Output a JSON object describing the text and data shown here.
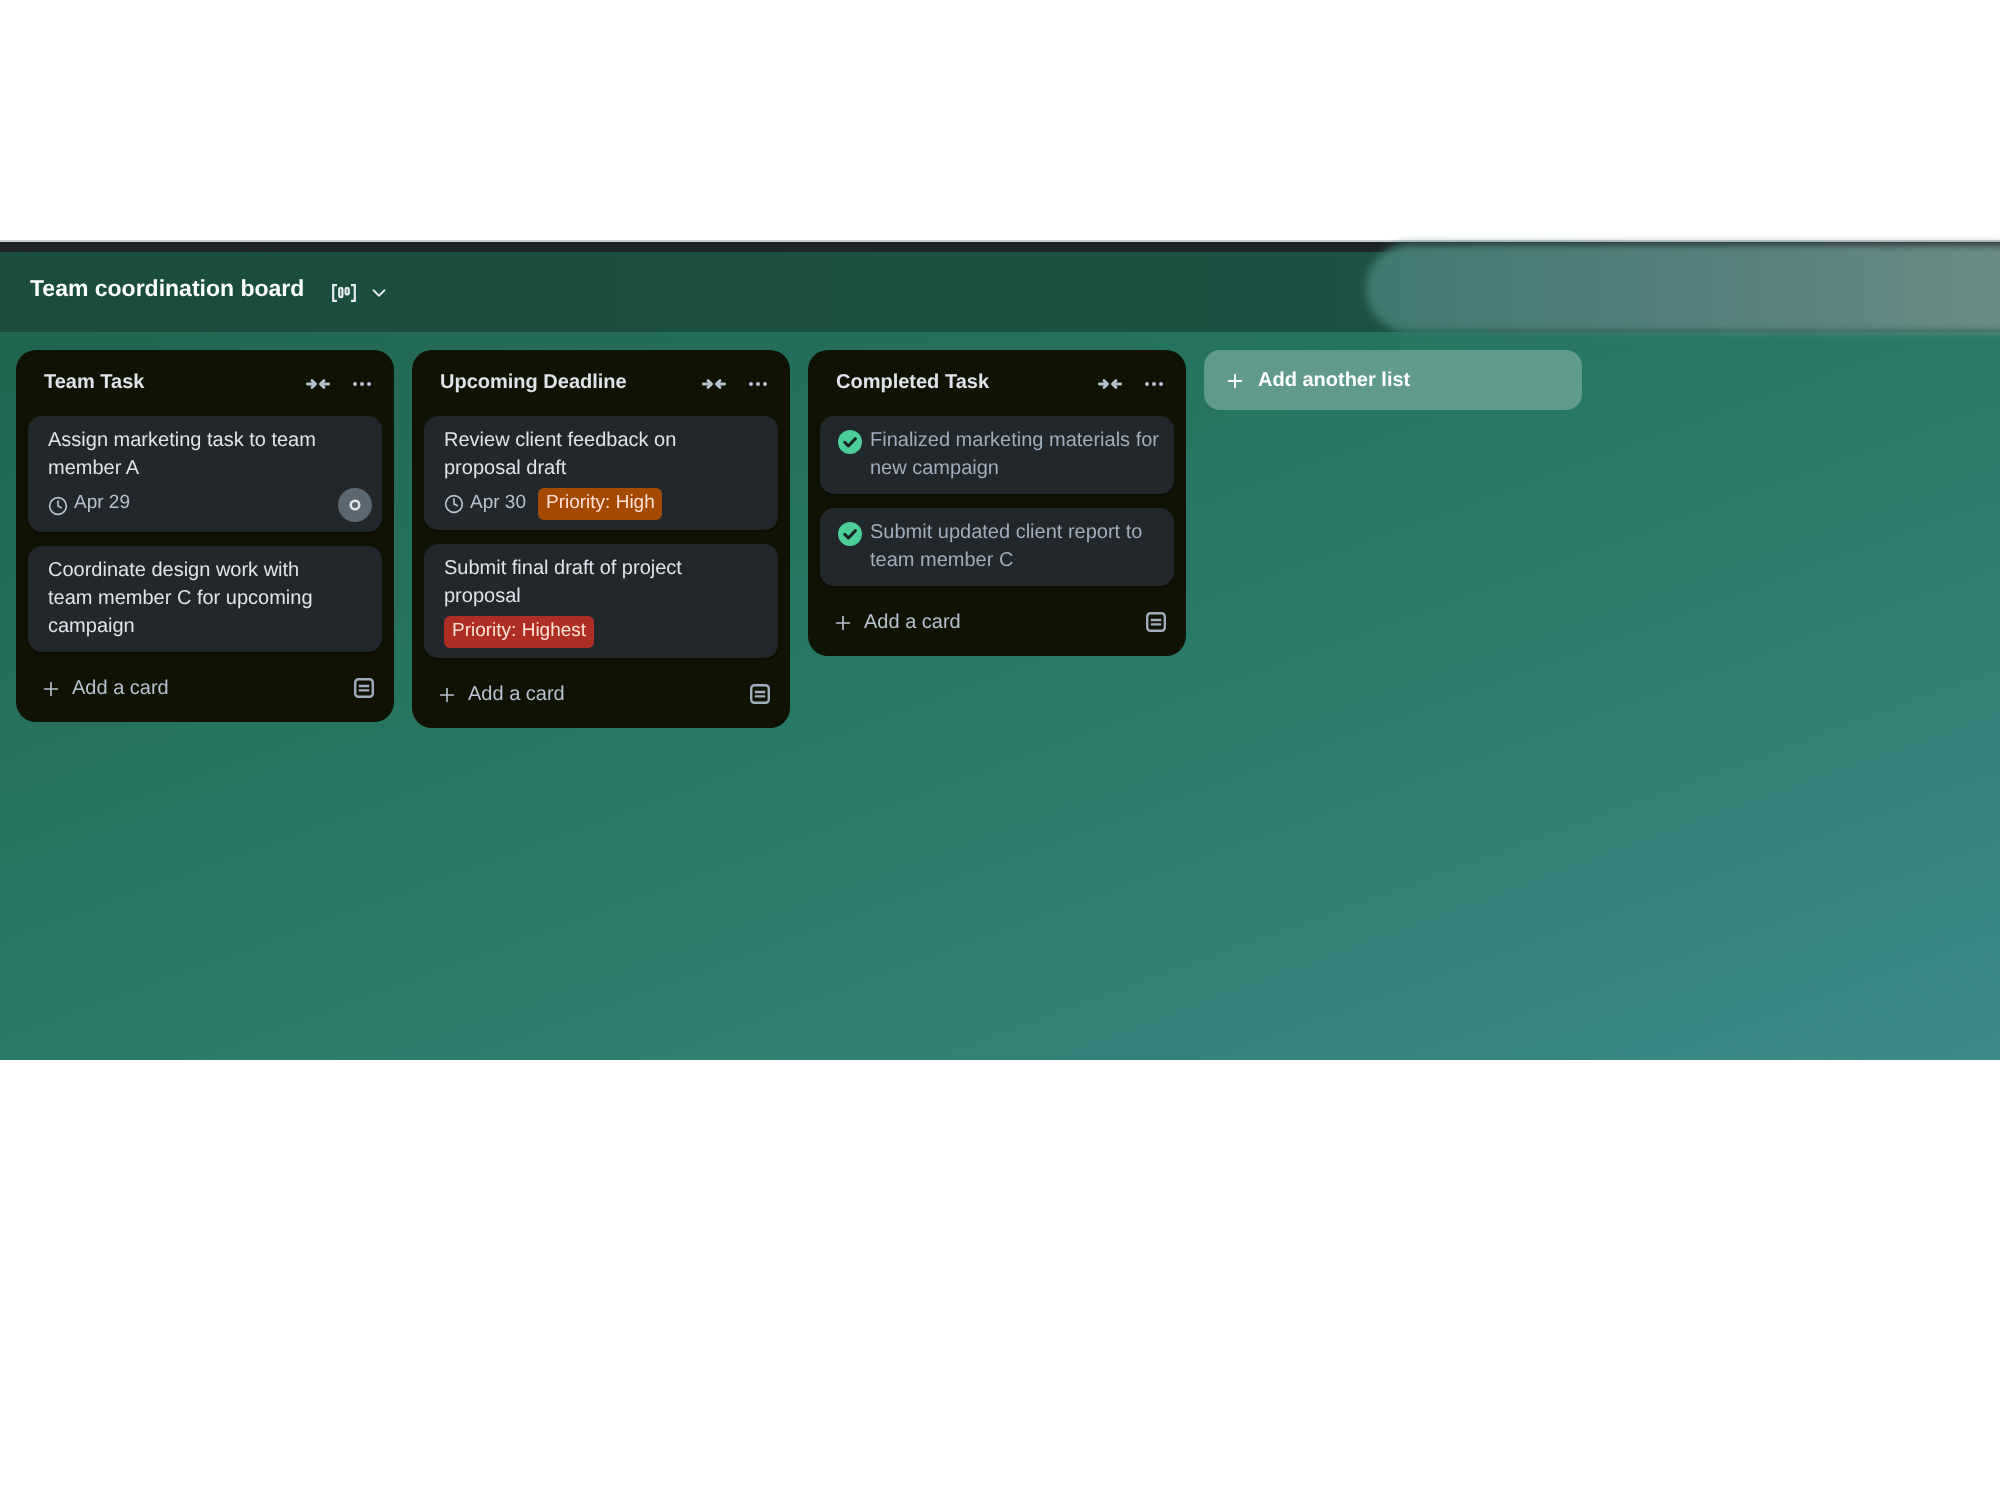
{
  "board": {
    "title": "Team coordination board"
  },
  "lists": [
    {
      "title": "Team Task",
      "cards": [
        {
          "title": "Assign marketing task to team member A",
          "completed": false,
          "due": "Apr 29",
          "avatar": true
        },
        {
          "title": "Coordinate design work with team member C for upcoming campaign",
          "completed": false,
          "avatar": false
        }
      ],
      "add_card": "Add a card"
    },
    {
      "title": "Upcoming Deadline",
      "cards": [
        {
          "title": "Review client feedback on proposal draft",
          "completed": false,
          "due": "Apr 30",
          "labels": [
            {
              "text": "Priority: High",
              "color": "#a54800"
            }
          ],
          "avatar": false
        },
        {
          "title": "Submit final draft of project proposal",
          "completed": false,
          "labels": [
            {
              "text": "Priority: Highest",
              "color": "#ae2e24"
            }
          ],
          "avatar": false
        }
      ],
      "add_card": "Add a card"
    },
    {
      "title": "Completed Task",
      "cards": [
        {
          "title": "Finalized marketing materials for new campaign",
          "completed": true,
          "avatar": false
        },
        {
          "title": "Submit updated client report to team member C",
          "completed": true,
          "avatar": false
        }
      ],
      "add_card": "Add a card"
    }
  ],
  "add_list": "Add another list"
}
